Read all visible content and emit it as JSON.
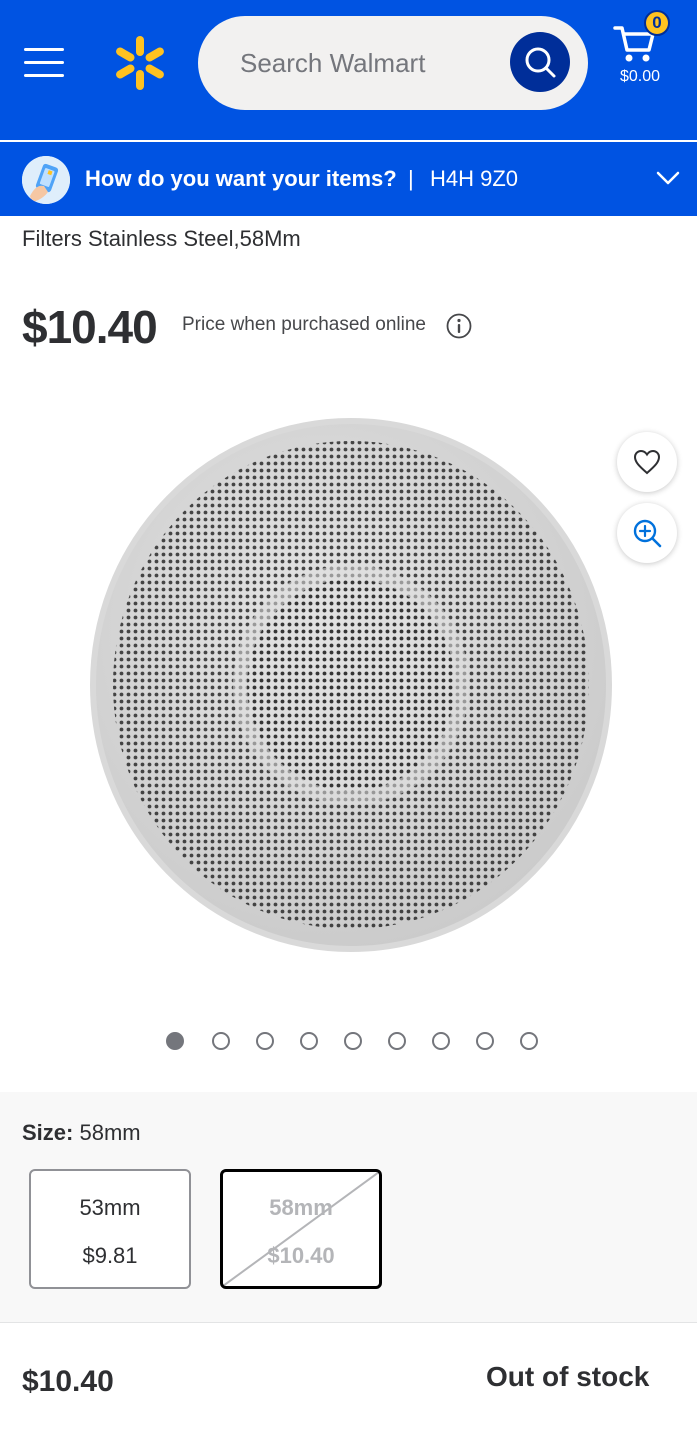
{
  "header": {
    "search_placeholder": "Search Walmart",
    "cart_count": "0",
    "cart_total": "$0.00",
    "brand_color": "#0053e2",
    "spark_color": "#ffc220"
  },
  "delivery": {
    "question": "How do you want your items?",
    "separator": "|",
    "postal_code": "H4H 9Z0"
  },
  "product": {
    "title": "Filters Stainless Steel,58Mm",
    "price": "$10.40",
    "price_note": "Price when purchased online",
    "image_count": 9,
    "active_image": 1
  },
  "variants": {
    "size_label": "Size:",
    "size_value": "58mm",
    "options": [
      {
        "label": "53mm",
        "price": "$9.81",
        "available": true
      },
      {
        "label": "58mm",
        "price": "$10.40",
        "available": false,
        "selected": true
      }
    ]
  },
  "bottom_bar": {
    "price": "$10.40",
    "status": "Out of stock"
  }
}
